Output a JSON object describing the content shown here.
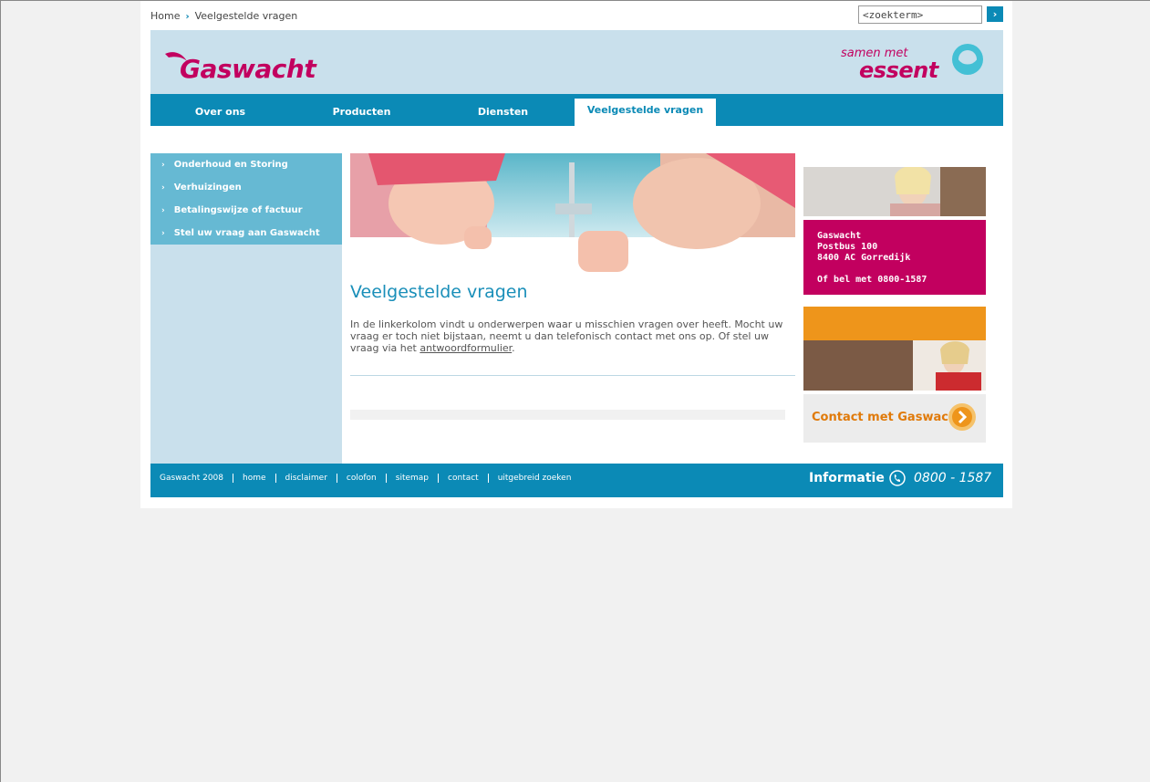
{
  "breadcrumb": {
    "home": "Home",
    "separator": "›",
    "current": "Veelgestelde vragen"
  },
  "search": {
    "placeholder": "<zoekterm>",
    "button": "›"
  },
  "header": {
    "logo": "Gaswacht",
    "partner_small": "samen met",
    "partner_big": "essent"
  },
  "nav": [
    {
      "label": "Over ons"
    },
    {
      "label": "Producten"
    },
    {
      "label": "Diensten"
    },
    {
      "label": "Veelgestelde vragen"
    }
  ],
  "sidebar": {
    "items": [
      {
        "label": "Onderhoud en Storing"
      },
      {
        "label": "Verhuizingen"
      },
      {
        "label": "Betalingswijze of factuur"
      },
      {
        "label": "Stel uw vraag aan Gaswacht"
      }
    ]
  },
  "content": {
    "title": "Veelgestelde vragen",
    "text_before": "In de linkerkolom vindt u onderwerpen waar u misschien vragen over heeft. Mocht uw vraag er toch niet bijstaan, neemt u dan telefonisch contact met ons op. Of stel uw vraag via het ",
    "link": "antwoordformulier",
    "text_after": "."
  },
  "address_card": {
    "line1": "Gaswacht",
    "line2": "Postbus 100",
    "line3": "8400 AC Gorredijk",
    "line4": "Of bel met 0800-1587"
  },
  "contact_card": {
    "label": "Contact met Gaswacht"
  },
  "footer": {
    "links": [
      "Gaswacht 2008",
      "home",
      "disclaimer",
      "colofon",
      "sitemap",
      "contact",
      "uitgebreid zoeken"
    ],
    "info_label": "Informatie",
    "phone": "0800 - 1587"
  },
  "colors": {
    "brand_blue": "#0b8ab6",
    "light_blue": "#c9e0ec",
    "magenta": "#c2005f",
    "orange": "#ee951b"
  }
}
